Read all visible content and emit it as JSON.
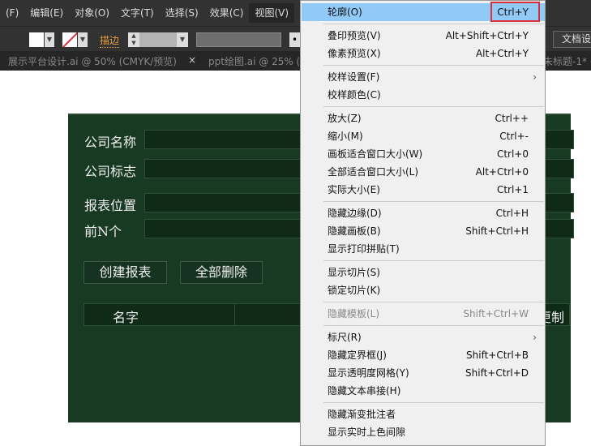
{
  "menubar": {
    "items": [
      "(F)",
      "编辑(E)",
      "对象(O)",
      "文字(T)",
      "选择(S)",
      "效果(C)",
      "视图(V)"
    ],
    "active": "视图(V)"
  },
  "toolbar": {
    "stroke_label": "描边",
    "doc_setup": "文档设"
  },
  "tabs": [
    {
      "label": "展示平台设计.ai @ 50% (CMYK/预览)",
      "close": "×"
    },
    {
      "label": "ppt绘图.ai @ 25% ("
    },
    {
      "label": "未标题-1* ("
    }
  ],
  "panel": {
    "fields": [
      "公司名称",
      "公司标志",
      "报表位置",
      "前N个"
    ],
    "buttons": [
      "创建报表",
      "全部删除"
    ],
    "columns": [
      "名字",
      "更制"
    ]
  },
  "menu": {
    "groups": [
      [
        {
          "label": "轮廓(O)",
          "shortcut": "Ctrl+Y",
          "highlight": true
        }
      ],
      [
        {
          "label": "叠印预览(V)",
          "shortcut": "Alt+Shift+Ctrl+Y"
        },
        {
          "label": "像素预览(X)",
          "shortcut": "Alt+Ctrl+Y"
        }
      ],
      [
        {
          "label": "校样设置(F)",
          "submenu": true
        },
        {
          "label": "校样颜色(C)"
        }
      ],
      [
        {
          "label": "放大(Z)",
          "shortcut": "Ctrl++"
        },
        {
          "label": "缩小(M)",
          "shortcut": "Ctrl+-"
        },
        {
          "label": "画板适合窗口大小(W)",
          "shortcut": "Ctrl+0"
        },
        {
          "label": "全部适合窗口大小(L)",
          "shortcut": "Alt+Ctrl+0"
        },
        {
          "label": "实际大小(E)",
          "shortcut": "Ctrl+1"
        }
      ],
      [
        {
          "label": "隐藏边缘(D)",
          "shortcut": "Ctrl+H"
        },
        {
          "label": "隐藏画板(B)",
          "shortcut": "Shift+Ctrl+H"
        },
        {
          "label": "显示打印拼贴(T)"
        }
      ],
      [
        {
          "label": "显示切片(S)"
        },
        {
          "label": "锁定切片(K)"
        }
      ],
      [
        {
          "label": "隐藏模板(L)",
          "shortcut": "Shift+Ctrl+W",
          "disabled": true
        }
      ],
      [
        {
          "label": "标尺(R)",
          "submenu": true
        },
        {
          "label": "隐藏定界框(J)",
          "shortcut": "Shift+Ctrl+B"
        },
        {
          "label": "显示透明度网格(Y)",
          "shortcut": "Shift+Ctrl+D"
        },
        {
          "label": "隐藏文本串接(H)"
        }
      ],
      [
        {
          "label": "隐藏渐变批注者"
        },
        {
          "label": "显示实时上色间隙"
        }
      ]
    ]
  },
  "colors": {
    "panel": "#183a22",
    "highlight": "#91c9f7",
    "annotation": "#d9303c",
    "stroke_label": "#e8a040"
  }
}
